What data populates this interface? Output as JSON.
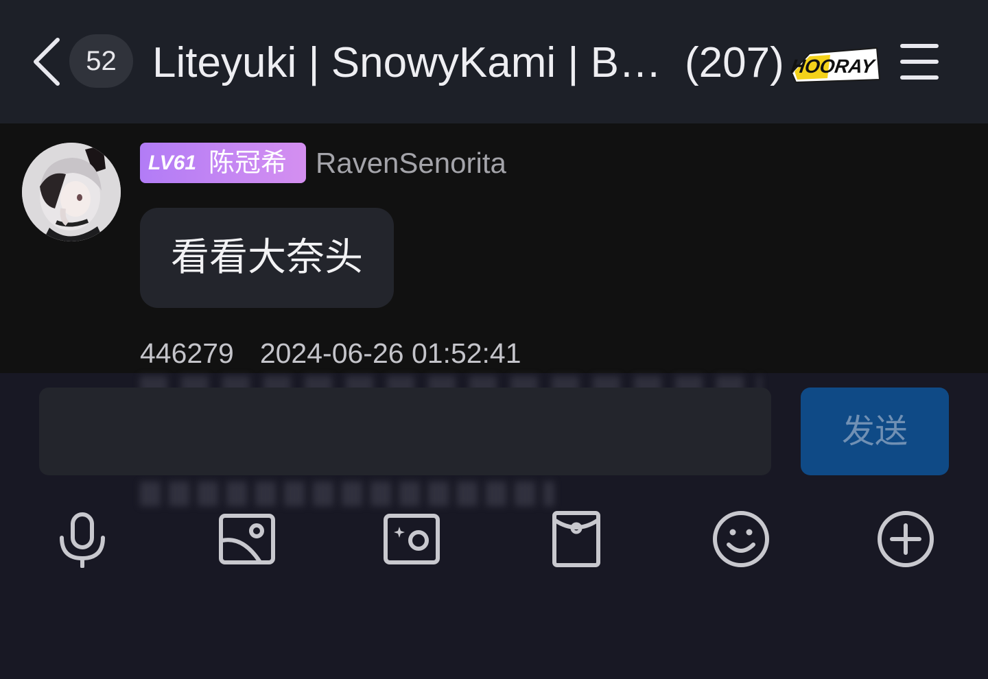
{
  "header": {
    "unread_count": "52",
    "title": "Liteyuki | SnowyKami | Bot交流群",
    "member_count": "(207)",
    "badge_text": "HOORAY",
    "back_icon": "chevron-left-icon",
    "menu_icon": "hamburger-menu-icon"
  },
  "message": {
    "level": "LV61",
    "title_badge": "陈冠希",
    "sender": "RavenSenorita",
    "text": "看看大奈头",
    "message_id": "446279",
    "timestamp": "2024-06-26 01:52:41"
  },
  "input": {
    "send_label": "发送"
  },
  "toolbar": {
    "icons": [
      "microphone-icon",
      "image-icon",
      "camera-icon",
      "red-packet-icon",
      "emoji-icon",
      "plus-icon"
    ]
  },
  "colors": {
    "header_bg": "#1d2028",
    "message_bg": "#111111",
    "bottom_bg": "#181824",
    "bubble_bg": "#23252c",
    "send_button": "#0f4a86",
    "level_badge_start": "#b27cf6",
    "level_badge_end": "#d48ff0"
  }
}
